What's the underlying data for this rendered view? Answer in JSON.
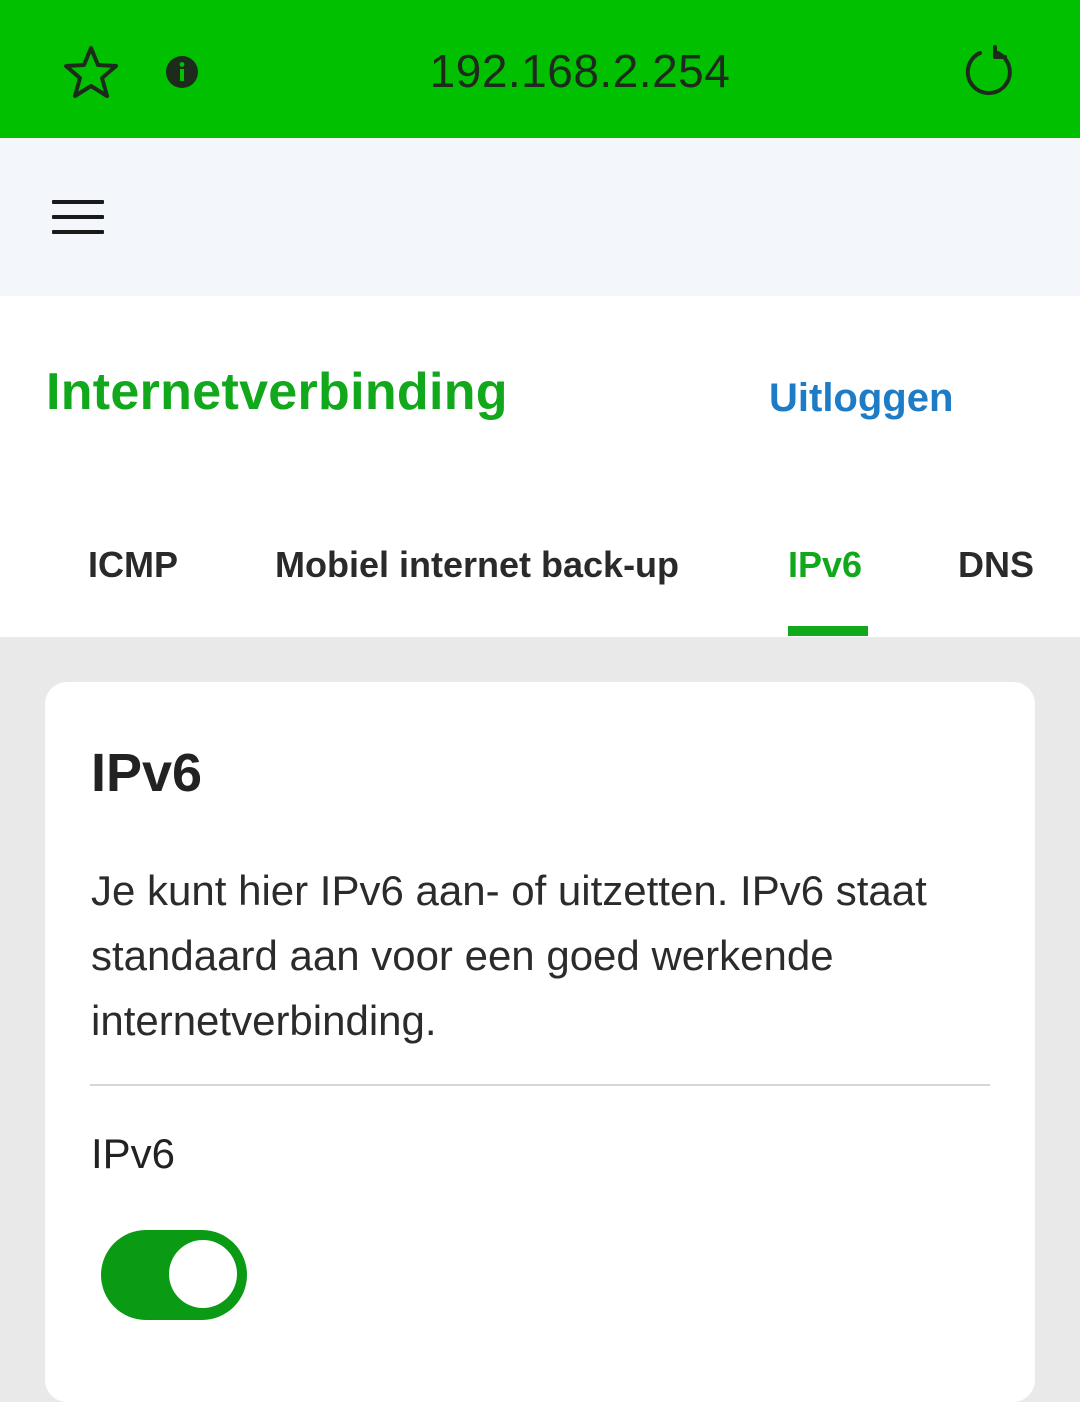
{
  "browser": {
    "url": "192.168.2.254",
    "icons": [
      "star-icon",
      "info-icon",
      "reload-icon"
    ],
    "bar_color": "#00c000"
  },
  "header": {
    "menu_icon": "hamburger-menu-icon"
  },
  "page": {
    "title": "Internetverbinding",
    "logout_label": "Uitloggen",
    "accent_color": "#11a81b",
    "link_color": "#1e7bc6"
  },
  "tabs": [
    {
      "label": "ICMP",
      "active": false
    },
    {
      "label": "Mobiel internet back-up",
      "active": false
    },
    {
      "label": "IPv6",
      "active": true
    },
    {
      "label": "DNS",
      "active": false
    }
  ],
  "card": {
    "title": "IPv6",
    "description": "Je kunt hier IPv6 aan- of uitzetten. IPv6 staat standaard aan voor een goed werkende internetverbinding.",
    "field_label": "IPv6",
    "toggle_on": true,
    "toggle_color": "#0a9a14"
  }
}
